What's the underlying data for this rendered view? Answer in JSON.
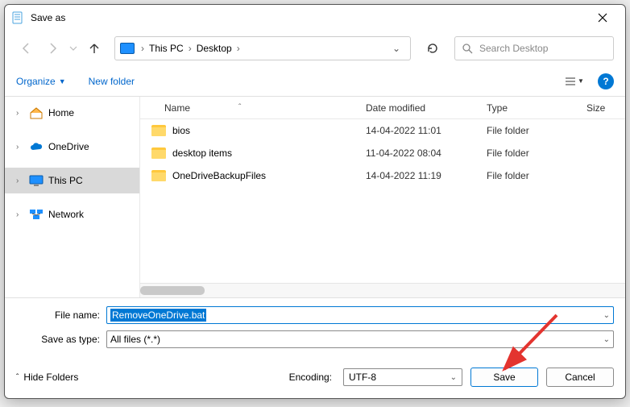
{
  "window": {
    "title": "Save as"
  },
  "breadcrumb": {
    "root": "This PC",
    "folder": "Desktop"
  },
  "search": {
    "placeholder": "Search Desktop"
  },
  "toolbar": {
    "organize": "Organize",
    "newfolder": "New folder"
  },
  "sidebar": {
    "home": "Home",
    "onedrive": "OneDrive",
    "thispc": "This PC",
    "network": "Network"
  },
  "columns": {
    "name": "Name",
    "date": "Date modified",
    "type": "Type",
    "size": "Size"
  },
  "rows": [
    {
      "name": "bios",
      "date": "14-04-2022 11:01",
      "type": "File folder"
    },
    {
      "name": "desktop items",
      "date": "11-04-2022 08:04",
      "type": "File folder"
    },
    {
      "name": "OneDriveBackupFiles",
      "date": "14-04-2022 11:19",
      "type": "File folder"
    }
  ],
  "labels": {
    "filename": "File name:",
    "saveastype": "Save as type:",
    "encoding": "Encoding:",
    "hidefolders": "Hide Folders"
  },
  "values": {
    "filename": "RemoveOneDrive.bat",
    "saveastype": "All files  (*.*)",
    "encoding": "UTF-8"
  },
  "buttons": {
    "save": "Save",
    "cancel": "Cancel"
  }
}
